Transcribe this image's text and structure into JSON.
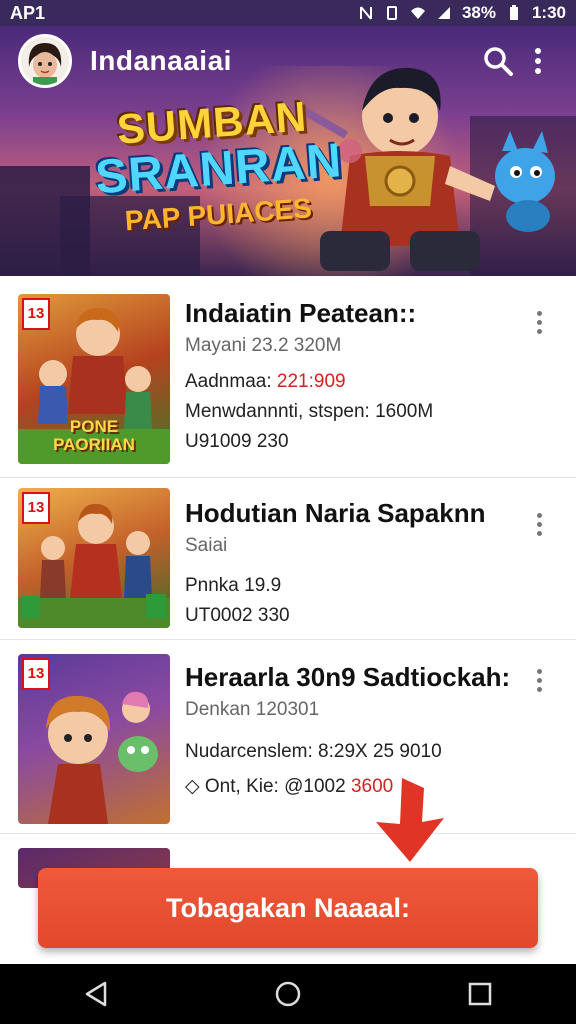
{
  "status_bar": {
    "left_text": "AP1",
    "battery_text": "38%",
    "time": "1:30"
  },
  "app_bar": {
    "title": "Indanaaiai"
  },
  "hero": {
    "line1": "SUMBAN",
    "line2": "SRANRAN",
    "line3": "PAP PUIACES"
  },
  "items": [
    {
      "age_badge": "13",
      "thumb_caption": "PONE PAORIIAN",
      "title": "Indaiatin Peatean::",
      "subtitle": "Mayani 23.2 320M",
      "line1_label": "Aadnmaa:",
      "line1_value": "221:909",
      "line2": "Menwdannnti, stspen: 1600M",
      "line3": "U91009 230"
    },
    {
      "age_badge": "13",
      "thumb_caption": "",
      "title": "Hodutian Naria Sapaknn",
      "subtitle": "Saiai",
      "line1_label": "Pnnka 19.9",
      "line1_value": "",
      "line2": "UT0002 330",
      "line3": ""
    },
    {
      "age_badge": "13",
      "thumb_caption": "",
      "title": "Heraarla 30n9 Sadtiockah:",
      "subtitle": "Denkan 120301",
      "line1_label": "Nudarcenslem: 8:29X 25 9010",
      "line1_value": "",
      "line2_prefix": "Ont, Kie: @1002",
      "line2_value": "3600",
      "line3": ""
    }
  ],
  "cta": {
    "label": "Tobagakan Naaaal:"
  },
  "colors": {
    "accent": "#e8502f",
    "header": "#3a2a5c",
    "badge_red": "#d11111",
    "price_red": "#d32222"
  }
}
